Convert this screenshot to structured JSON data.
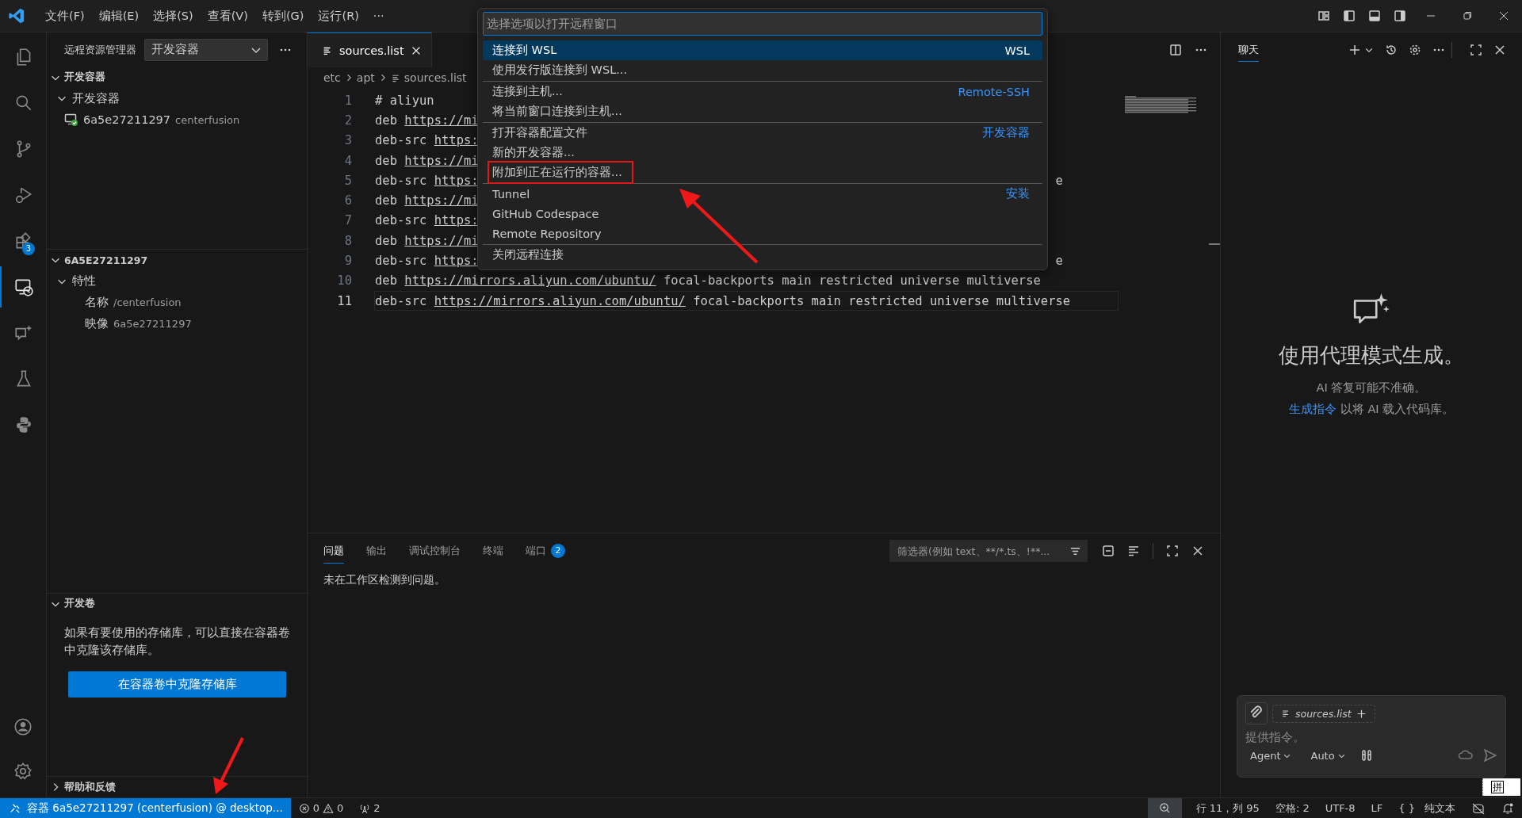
{
  "menu_bar": {
    "items": [
      "文件(F)",
      "编辑(E)",
      "选择(S)",
      "查看(V)",
      "转到(G)",
      "运行(R)",
      "···"
    ]
  },
  "activity_bar": {
    "items": [
      {
        "kind": "explorer",
        "selected": false
      },
      {
        "kind": "search",
        "selected": false
      },
      {
        "kind": "source-control",
        "selected": false
      },
      {
        "kind": "run-debug",
        "selected": false
      },
      {
        "kind": "extensions",
        "selected": false,
        "badge": "3"
      },
      {
        "kind": "remote",
        "selected": true
      },
      {
        "kind": "chat",
        "selected": false
      },
      {
        "kind": "testing",
        "selected": false
      },
      {
        "kind": "python",
        "selected": false
      }
    ]
  },
  "sidebar": {
    "title": "远程资源管理器",
    "dropdown": "开发容器",
    "sections": [
      {
        "kind": "tree",
        "title": "开发容器",
        "expanded": true,
        "children": [
          {
            "label": "开发容器",
            "expanded": true,
            "children": [
              {
                "label": "6a5e27211297",
                "description": "centerfusion",
                "kind": "container"
              }
            ]
          }
        ]
      },
      {
        "kind": "tree",
        "title": "6A5E27211297",
        "expanded": true,
        "children": [
          {
            "label": "特性",
            "expanded": true,
            "children": [
              {
                "label": "名称",
                "description": "/centerfusion"
              },
              {
                "label": "映像",
                "description": "6a5e27211297"
              }
            ]
          }
        ]
      },
      {
        "kind": "message",
        "title": "开发卷",
        "expanded": true,
        "text": "如果有要使用的存储库，可以直接在容器卷中克隆该存储库。",
        "button": "在容器卷中克隆存储库"
      },
      {
        "title": "帮助和反馈",
        "expanded": false
      }
    ]
  },
  "editor": {
    "tab": {
      "label": "sources.list",
      "selected": true
    },
    "breadcrumbs": [
      "etc",
      "apt",
      "sources.list"
    ],
    "lines": [
      {
        "number": "1",
        "head": "# aliyun",
        "current": false
      },
      {
        "number": "2",
        "head": "deb",
        "url": "https://mi",
        "current": false
      },
      {
        "number": "3",
        "head": "deb-src",
        "url": "https:",
        "current": false
      },
      {
        "number": "4",
        "head": "deb",
        "url": "https://mi",
        "current": false
      },
      {
        "number": "5",
        "head": "deb-src",
        "url": "https:",
        "tail": "e",
        "current": false
      },
      {
        "number": "6",
        "head": "deb",
        "url": "https://mi",
        "current": false
      },
      {
        "number": "7",
        "head": "deb-src",
        "url": "https:",
        "current": false
      },
      {
        "number": "8",
        "head": "deb",
        "url": "https://mi",
        "current": false
      },
      {
        "number": "9",
        "head": "deb-src",
        "url": "https:",
        "tail": "e",
        "current": false
      },
      {
        "number": "10",
        "head": "deb",
        "url": "https://mirrors.aliyun.com/ubuntu/",
        "rest": "focal-backports main restricted universe multiverse",
        "current": false
      },
      {
        "number": "11",
        "head": "deb-src",
        "url": "https://mirrors.aliyun.com/ubuntu/",
        "rest": "focal-backports main restricted universe multiverse",
        "current": true
      }
    ]
  },
  "quick_pick": {
    "placeholder": "选择选项以打开远程窗口",
    "items": [
      {
        "label": "连接到 WSL",
        "detail": "WSL",
        "detail_is_link": false,
        "selected": true,
        "highlighted": false,
        "group_start": false
      },
      {
        "label": "使用发行版连接到 WSL...",
        "selected": false,
        "highlighted": false,
        "group_start": false
      },
      {
        "label": "连接到主机...",
        "detail": "Remote-SSH",
        "detail_is_link": true,
        "selected": false,
        "highlighted": false,
        "group_start": true
      },
      {
        "label": "将当前窗口连接到主机...",
        "selected": false,
        "highlighted": false,
        "group_start": false
      },
      {
        "label": "打开容器配置文件",
        "detail": "开发容器",
        "detail_is_link": true,
        "selected": false,
        "highlighted": false,
        "group_start": true
      },
      {
        "label": "新的开发容器...",
        "selected": false,
        "highlighted": false,
        "group_start": false
      },
      {
        "label": "附加到正在运行的容器...",
        "selected": false,
        "highlighted": true,
        "group_start": false
      },
      {
        "label": "Tunnel",
        "detail": "安装",
        "detail_is_link": true,
        "selected": false,
        "highlighted": false,
        "group_start": true
      },
      {
        "label": "GitHub Codespace",
        "selected": false,
        "highlighted": false,
        "group_start": false
      },
      {
        "label": "Remote Repository",
        "selected": false,
        "highlighted": false,
        "group_start": false
      },
      {
        "label": "关闭远程连接",
        "selected": false,
        "highlighted": false,
        "group_start": true
      }
    ]
  },
  "panel": {
    "tabs": [
      {
        "label": "问题",
        "selected": true
      },
      {
        "label": "输出",
        "selected": false
      },
      {
        "label": "调试控制台",
        "selected": false
      },
      {
        "label": "终端",
        "selected": false
      },
      {
        "label": "端口",
        "selected": false,
        "badge": "2"
      }
    ],
    "filter": {
      "placeholder": "筛选器(例如 text、**/*.ts、!**..."
    },
    "message": "未在工作区检测到问题。"
  },
  "chat": {
    "tab": {
      "label": "聊天",
      "selected": true
    },
    "heading": "使用代理模式生成。",
    "note": "AI 答复可能不准确。",
    "link": "生成指令",
    "link_rest": "以将 AI 载入代码库。",
    "input": {
      "attachment": "sources.list",
      "placeholder": "提供指令。",
      "mode": "Agent",
      "model": "Auto"
    }
  },
  "status_bar": {
    "remote": "容器 6a5e27211297 (centerfusion) @ desktop...",
    "errors": "0",
    "warnings": "0",
    "ports": "2",
    "right": [
      {
        "kind": "zoom"
      },
      {
        "kind": "text",
        "label": "行 11，列 95"
      },
      {
        "kind": "text",
        "label": "空格: 2"
      },
      {
        "kind": "text",
        "label": "UTF-8"
      },
      {
        "kind": "text",
        "label": "LF"
      },
      {
        "kind": "language",
        "icon": "{ }",
        "label": "纯文本"
      },
      {
        "kind": "copilot"
      },
      {
        "kind": "bell"
      }
    ]
  },
  "ime": {
    "label": "拼"
  }
}
